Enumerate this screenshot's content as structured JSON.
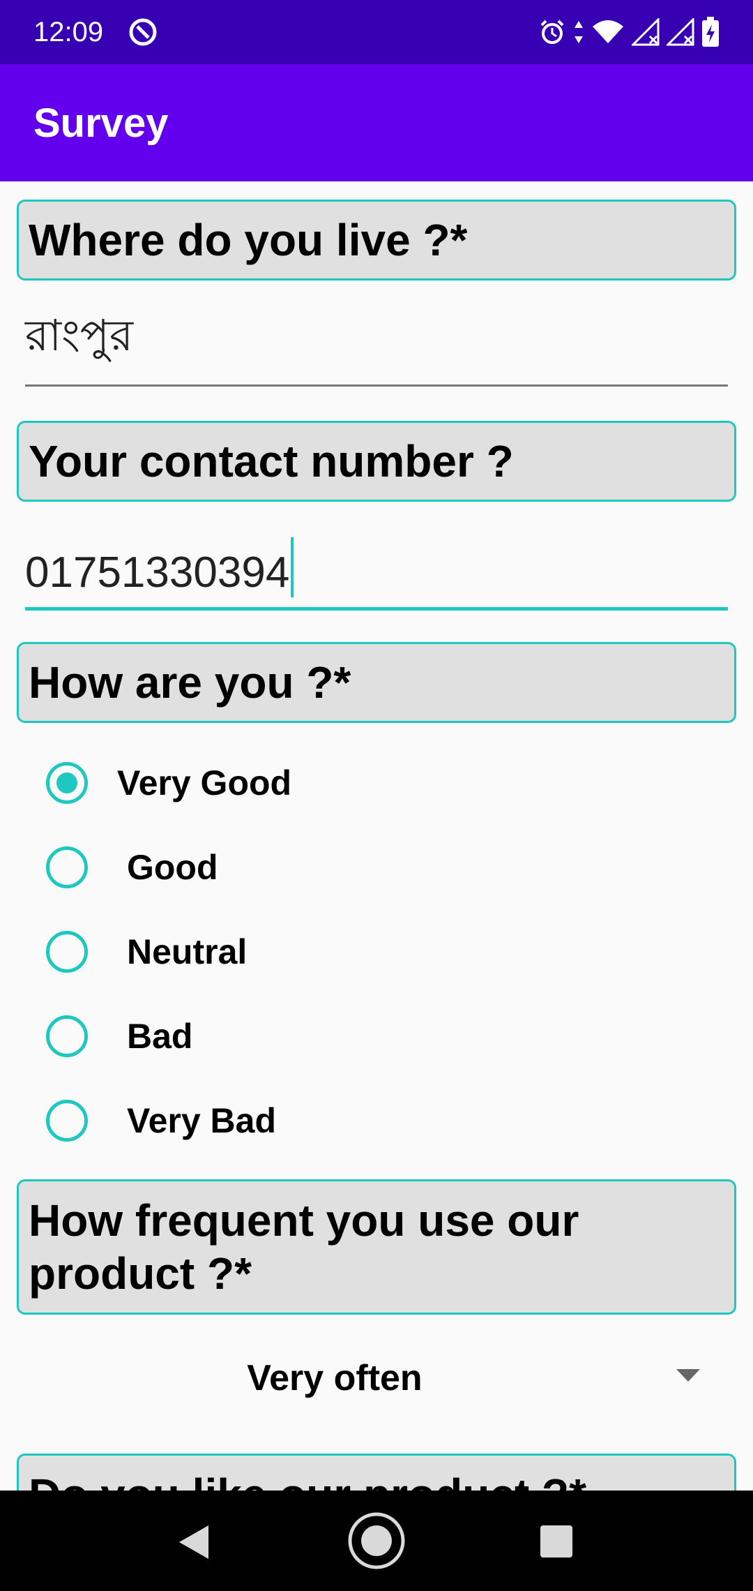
{
  "status_bar": {
    "time": "12:09",
    "left_icon": "data-saver-icon",
    "right_icons": [
      "alarm-icon",
      "data-arrows-icon",
      "wifi-icon",
      "signal-icon",
      "signal-icon",
      "battery-charging-icon"
    ],
    "wifi_badge": "4"
  },
  "app_bar": {
    "title": "Survey"
  },
  "form": {
    "q1": {
      "label": "Where do you live ?*",
      "answer": "রাংপুর"
    },
    "q2": {
      "label": "Your contact number ?",
      "answer": "01751330394"
    },
    "q3": {
      "label": "How are you ?*",
      "options": [
        "Very Good",
        "Good",
        "Neutral",
        "Bad",
        "Very Bad"
      ],
      "selected": "Very Good"
    },
    "q4": {
      "label": "How frequent you use our product ?*",
      "selected": "Very often"
    },
    "q5": {
      "label": "Do you like our product ?*"
    }
  },
  "nav_bar": {
    "icons": [
      "back-icon",
      "home-icon",
      "recents-icon"
    ]
  },
  "colors": {
    "status_bar": "#3700b3",
    "app_bar": "#6200ee",
    "accent": "#1ec8c0",
    "question_bg": "#e0e0e0"
  }
}
